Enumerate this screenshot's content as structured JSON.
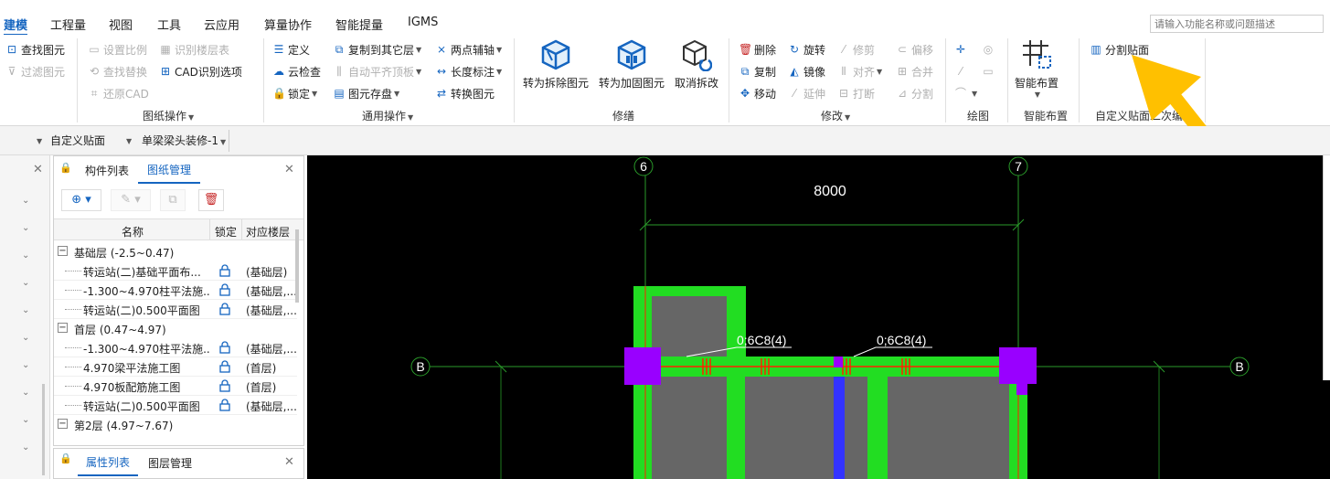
{
  "menu": {
    "tabs": [
      "建模",
      "工程量",
      "视图",
      "工具",
      "云应用",
      "算量协作",
      "智能提量",
      "IGMS"
    ],
    "active_index": 0,
    "search_placeholder": "请输入功能名称或问题描述"
  },
  "ribbon": {
    "drawing_ops": {
      "find_element": "查找图元",
      "filter_element": "过滤图元",
      "set_scale": "设置比例",
      "identify_floor_table": "识别楼层表",
      "find_replace": "查找替换",
      "cad_identify_options": "CAD识别选项",
      "restore_cad": "还原CAD",
      "group_label": "图纸操作"
    },
    "common_ops": {
      "define": "定义",
      "copy_to_other_floor": "复制到其它层",
      "two_point_axis": "两点辅轴",
      "cloud_check": "云检查",
      "auto_align_slab": "自动平齐顶板",
      "length_dimension": "长度标注",
      "lock": "锁定",
      "element_save": "图元存盘",
      "convert_element": "转换图元",
      "group_label": "通用操作"
    },
    "repair": {
      "to_demolish": "转为拆除图元",
      "to_reinforce": "转为加固图元",
      "cancel_demolish": "取消拆改",
      "group_label": "修缮"
    },
    "modify": {
      "delete": "删除",
      "rotate": "旋转",
      "trim": "修剪",
      "offset": "偏移",
      "copy": "复制",
      "mirror": "镜像",
      "align": "对齐",
      "merge": "合并",
      "move": "移动",
      "extend": "延伸",
      "break": "打断",
      "split": "分割",
      "group_label": "修改"
    },
    "draw": {
      "group_label": "绘图"
    },
    "smart_layout": {
      "button": "智能布置",
      "group_label": "智能布置"
    },
    "custom_patch": {
      "split_patch": "分割贴面",
      "group_label": "自定义贴面二次编"
    }
  },
  "subbar": {
    "element_type": "自定义贴面",
    "element_name": "单梁梁头装修-1"
  },
  "drawing_panel": {
    "tabs": [
      "构件列表",
      "图纸管理"
    ],
    "active_tab": 1,
    "columns": [
      "名称",
      "锁定",
      "对应楼层"
    ],
    "groups": [
      {
        "label": "基础层 (-2.5~0.47)",
        "rows": [
          {
            "name": "转运站(二)基础平面布...",
            "floor": "(基础层)"
          },
          {
            "name": "-1.300~4.970柱平法施...",
            "floor": "(基础层,..."
          },
          {
            "name": "转运站(二)0.500平面图",
            "floor": "(基础层,..."
          }
        ]
      },
      {
        "label": "首层 (0.47~4.97)",
        "rows": [
          {
            "name": "-1.300~4.970柱平法施...",
            "floor": "(基础层,..."
          },
          {
            "name": "4.970梁平法施工图",
            "floor": "(首层)"
          },
          {
            "name": "4.970板配筋施工图",
            "floor": "(首层)"
          },
          {
            "name": "转运站(二)0.500平面图",
            "floor": "(基础层,..."
          }
        ]
      },
      {
        "label": "第2层 (4.97~7.67)",
        "rows": []
      }
    ]
  },
  "property_panel": {
    "tabs": [
      "属性列表",
      "图层管理"
    ],
    "active_tab": 0
  },
  "canvas": {
    "axis_6": "6",
    "axis_7": "7",
    "axis_b_left": "B",
    "axis_b_right": "B",
    "dimension": "8000",
    "rebar_label_1": "0;6C8(4)",
    "rebar_label_2": "0;6C8(4)"
  },
  "colors": {
    "accent": "#1565c0",
    "canvas_bg": "#000000",
    "beam_green": "#22dd22",
    "column_purple": "#9900ff",
    "slab_gray": "#666666",
    "rebar_red": "#ff2200",
    "blue_bar": "#3333ff",
    "arrow_yellow": "#ffc000"
  }
}
